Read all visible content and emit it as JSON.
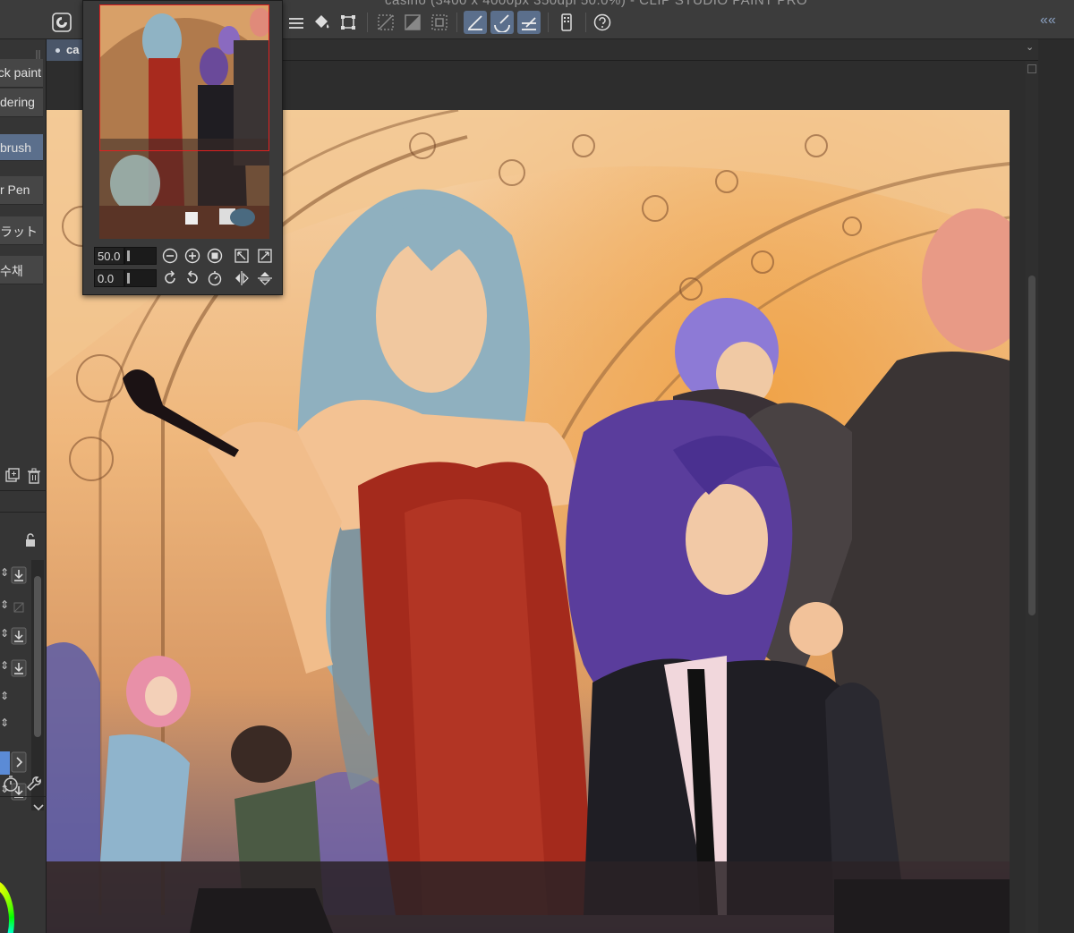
{
  "window": {
    "title": "casino (3400 x 4000px 350dpi 50.0%) - CLIP STUDIO PAINT PRO"
  },
  "tabs": [
    {
      "label": "ca"
    }
  ],
  "subtools": [
    {
      "label": "ck paint"
    },
    {
      "label": "dering"
    },
    {
      "label": "brush"
    },
    {
      "label": "r Pen"
    },
    {
      "label": "ラット"
    },
    {
      "label": "수채"
    }
  ],
  "navigator": {
    "zoom_value": "50.0",
    "rotation_value": "0.0"
  },
  "colors": {
    "accent": "#5b6f8c",
    "panel": "#353535",
    "toolbar": "#3c3c3c",
    "nav_frame": "#e02020"
  },
  "icons": {
    "toolbar": [
      "clip-logo-icon",
      "fill-icon",
      "transform-icon",
      "select-deselect-icon",
      "invert-selection-icon",
      "crop-icon",
      "ruler-snap-icon",
      "curve-snap-icon",
      "guide-snap-icon",
      "device-icon",
      "help-icon"
    ]
  }
}
